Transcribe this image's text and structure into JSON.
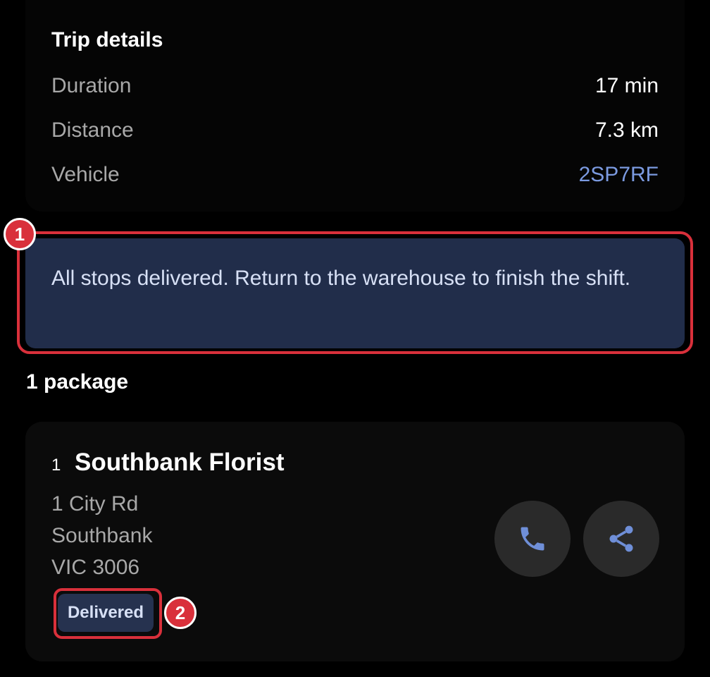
{
  "trip_details": {
    "title": "Trip details",
    "rows": [
      {
        "label": "Duration",
        "value": "17 min"
      },
      {
        "label": "Distance",
        "value": "7.3 km"
      },
      {
        "label": "Vehicle",
        "value": "2SP7RF"
      }
    ]
  },
  "banner": {
    "message": "All stops delivered. Return to the warehouse to finish the shift."
  },
  "packages": {
    "count_label": "1 package",
    "items": [
      {
        "index": "1",
        "name": "Southbank Florist",
        "address_lines": [
          "1 City Rd",
          "Southbank",
          "VIC 3006"
        ],
        "status": "Delivered",
        "call_icon": "phone-icon",
        "share_icon": "share-icon"
      }
    ]
  },
  "markers": [
    "1",
    "2"
  ],
  "colors": {
    "background": "#000000",
    "card": "#0b0b0b",
    "banner": "#212d4a",
    "accent": "#7b9ae0",
    "highlight": "#d9303b"
  }
}
